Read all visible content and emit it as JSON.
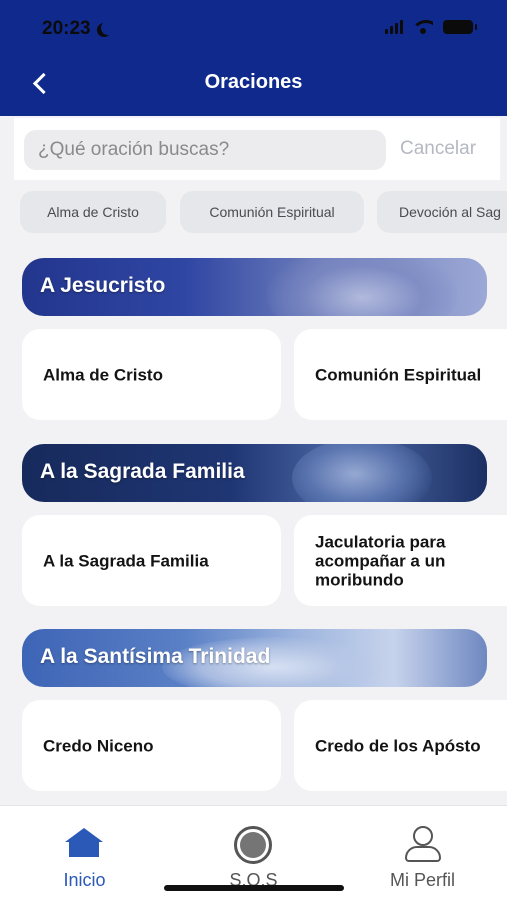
{
  "status_bar": {
    "time": "20:23"
  },
  "header": {
    "title": "Oraciones"
  },
  "search": {
    "placeholder": "¿Qué oración buscas?",
    "cancel_label": "Cancelar"
  },
  "chips": [
    "Alma de Cristo",
    "Comunión Espiritual",
    "Devoción al Sag"
  ],
  "sections": [
    {
      "title": "A Jesucristo",
      "cards": [
        "Alma de Cristo",
        "Comunión Espiritual"
      ]
    },
    {
      "title": "A la Sagrada Familia",
      "cards": [
        "A la Sagrada Familia",
        "Jaculatoria para acompañar a un moribundo"
      ]
    },
    {
      "title": "A la Santísima Trinidad",
      "cards": [
        "Credo Niceno",
        "Credo de los Apósto"
      ]
    }
  ],
  "tabbar": {
    "active_color": "#2a59b8",
    "inactive_color": "#555555",
    "tabs": [
      {
        "label": "Inicio",
        "icon": "home-icon"
      },
      {
        "label": "S.O.S",
        "icon": "sos-icon"
      },
      {
        "label": "Mi Perfil",
        "icon": "user-icon"
      }
    ]
  },
  "colors": {
    "header": "#0f2a8c",
    "background": "#f2f2f4"
  }
}
